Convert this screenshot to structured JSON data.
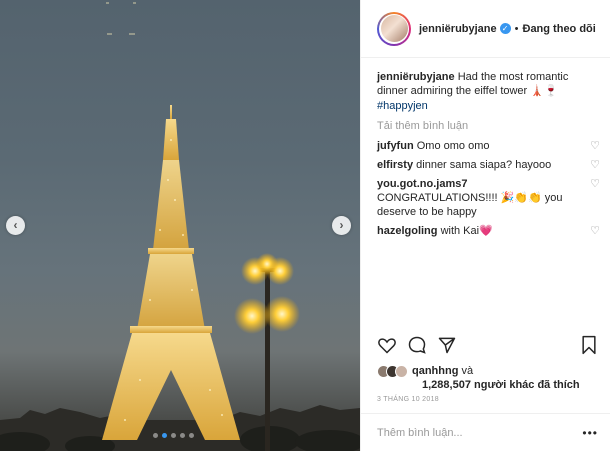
{
  "post": {
    "header": {
      "username": "jenniërubyjane",
      "verified_icon": "verified-icon",
      "separator": "•",
      "follow_label": "Đang theo dõi"
    },
    "caption": {
      "username": "jenniërubyjane",
      "text": "Had the most romantic dinner admiring the eiffel tower 🗼🍷",
      "hashtag": "#happyjen"
    },
    "load_more_label": "Tải thêm bình luận",
    "comments": [
      {
        "username": "jufyfun",
        "text": "Omo omo omo"
      },
      {
        "username": "elfirsty",
        "text": "dinner sama siapa? hayooo"
      },
      {
        "username": "you.got.no.jams7",
        "text": "CONGRATULATIONS!!!! 🎉👏👏 you deserve to be happy"
      },
      {
        "username": "hazelgoling",
        "text": "with Kai💗"
      }
    ],
    "likes": {
      "first_user": "qanhhng",
      "and_label": "và",
      "count": "1,288,507",
      "others_label": "người khác đã thích"
    },
    "date": "3 THÁNG 10 2018",
    "add_comment_placeholder": "Thêm bình luận...",
    "more_label": "•••",
    "colors": {
      "link": "#003569",
      "accent": "#3897f0",
      "muted": "#999999"
    }
  }
}
